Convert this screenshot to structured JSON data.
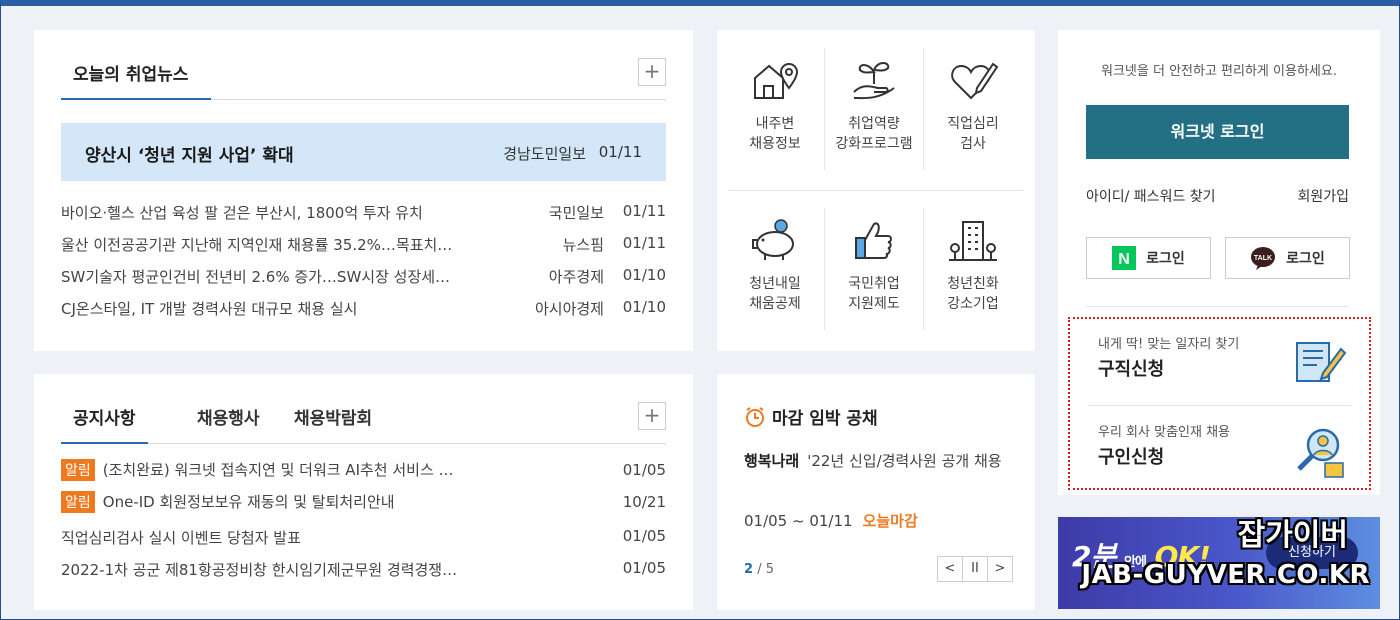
{
  "news": {
    "tab": "오늘의 취업뉴스",
    "more_label": "+",
    "headline": {
      "title": "양산시 ‘청년 지원 사업’ 확대",
      "source": "경남도민일보",
      "date": "01/11"
    },
    "items": [
      {
        "title": "바이오·헬스 산업 육성 팔 걷은 부산시, 1800억 투자 유치",
        "source": "국민일보",
        "date": "01/11"
      },
      {
        "title": "울산 이전공공기관 지난해 지역인재 채용률 35.2%…목표치…",
        "source": "뉴스핌",
        "date": "01/11"
      },
      {
        "title": "SW기술자 평균인건비 전년비 2.6% 증가…SW시장 성장세…",
        "source": "아주경제",
        "date": "01/10"
      },
      {
        "title": "CJ온스타일, IT 개발 경력사원 대규모 채용 실시",
        "source": "아시아경제",
        "date": "01/10"
      }
    ]
  },
  "notice": {
    "tabs": [
      "공지사항",
      "채용행사",
      "채용박람회"
    ],
    "more_label": "+",
    "badge": "알림",
    "items": [
      {
        "title": "(조치완료) 워크넷 접속지연 및 더워크 AI추천 서비스 …",
        "date": "01/05",
        "badge": true
      },
      {
        "title": "One-ID 회원정보보유 재동의 및 탈퇴처리안내",
        "date": "10/21",
        "badge": true
      },
      {
        "title": "직업심리검사 실시 이벤트 당첨자 발표",
        "date": "01/05",
        "badge": false
      },
      {
        "title": "2022-1차 공군 제81항공정비창 한시임기제군무원 경력경쟁…",
        "date": "01/05",
        "badge": false
      }
    ]
  },
  "services": [
    {
      "label": "내주변\n채용정보",
      "icon": "house-location-icon"
    },
    {
      "label": "취업역량\n강화프로그램",
      "icon": "sprout-hand-icon"
    },
    {
      "label": "직업심리\n검사",
      "icon": "heart-pen-icon"
    },
    {
      "label": "청년내일\n채움공제",
      "icon": "piggy-bank-icon"
    },
    {
      "label": "국민취업\n지원제도",
      "icon": "thumbs-up-icon"
    },
    {
      "label": "청년친화\n강소기업",
      "icon": "building-icon"
    }
  ],
  "deadline": {
    "title": "마감 임박 공채",
    "company": "행복나래",
    "posting": "'22년 신입/경력사원 공개 채용",
    "period": "01/05 ~ 01/11",
    "status": "오늘마감",
    "page_current": "2",
    "page_total": "/ 5",
    "prev": "<",
    "pause": "II",
    "next": ">"
  },
  "login": {
    "notice": "워크넷을 더 안전하고 편리하게 이용하세요.",
    "button": "워크넷 로그인",
    "find": "아이디/ 패스워드 찾기",
    "join": "회원가입",
    "naver": "로그인",
    "kakao": "로그인",
    "naver_mark": "N",
    "kakao_mark": "TALK",
    "quick": [
      {
        "sub": "내게 딱! 맞는 일자리 찾기",
        "title": "구직신청"
      },
      {
        "sub": "우리 회사 맞춤인재 채용",
        "title": "구인신청"
      }
    ]
  },
  "banner": {
    "big": "2분",
    "small": "안에",
    "ok": "OK!",
    "pill": "신청하기"
  },
  "watermark": {
    "line1": "잡가이버",
    "line2": "JAB-GUYVER.CO.KR"
  },
  "colors": {
    "accent": "#2a6aa8",
    "login": "#237085",
    "badge": "#ee7a1f",
    "highlight": "#d3e7f8",
    "quick_border": "#d81b1b"
  }
}
